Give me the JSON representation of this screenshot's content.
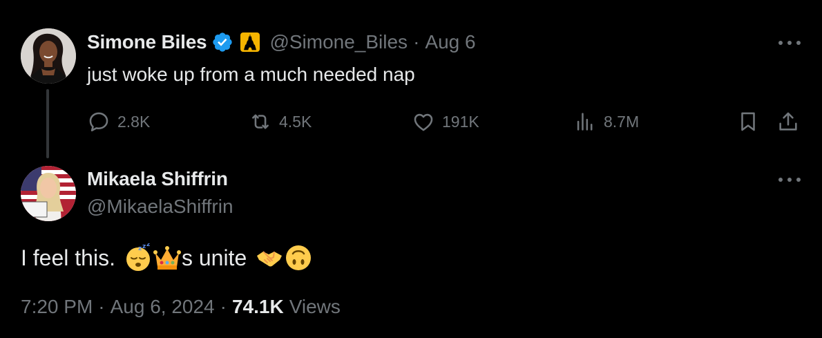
{
  "parent_tweet": {
    "display_name": "Simone Biles",
    "handle": "@Simone_Biles",
    "separator": "·",
    "date": "Aug 6",
    "text": "just woke up from a much needed nap",
    "verified": true,
    "affiliation_badge_icon": "eiffel-tower-icon",
    "stats": {
      "replies": "2.8K",
      "retweets": "4.5K",
      "likes": "191K",
      "views": "8.7M"
    }
  },
  "reply_tweet": {
    "display_name": "Mikaela Shiffrin",
    "handle": "@MikaelaShiffrin",
    "text_before": "I feel this.",
    "emoji_sleeping": "sleeping-face-emoji",
    "emoji_crown": "crown-emoji",
    "text_middle": "s unite",
    "emoji_handshake": "handshake-emoji",
    "emoji_upside_down": "upside-down-face-emoji",
    "timestamp": "7:20 PM",
    "date": "Aug 6, 2024",
    "separator": "·",
    "views_count": "74.1K",
    "views_label": "Views"
  },
  "colors": {
    "background": "#000000",
    "primary_text": "#e7e9ea",
    "secondary_text": "#71767b",
    "verified_blue": "#1d9bf0",
    "affiliation_gold": "#f5b400"
  }
}
